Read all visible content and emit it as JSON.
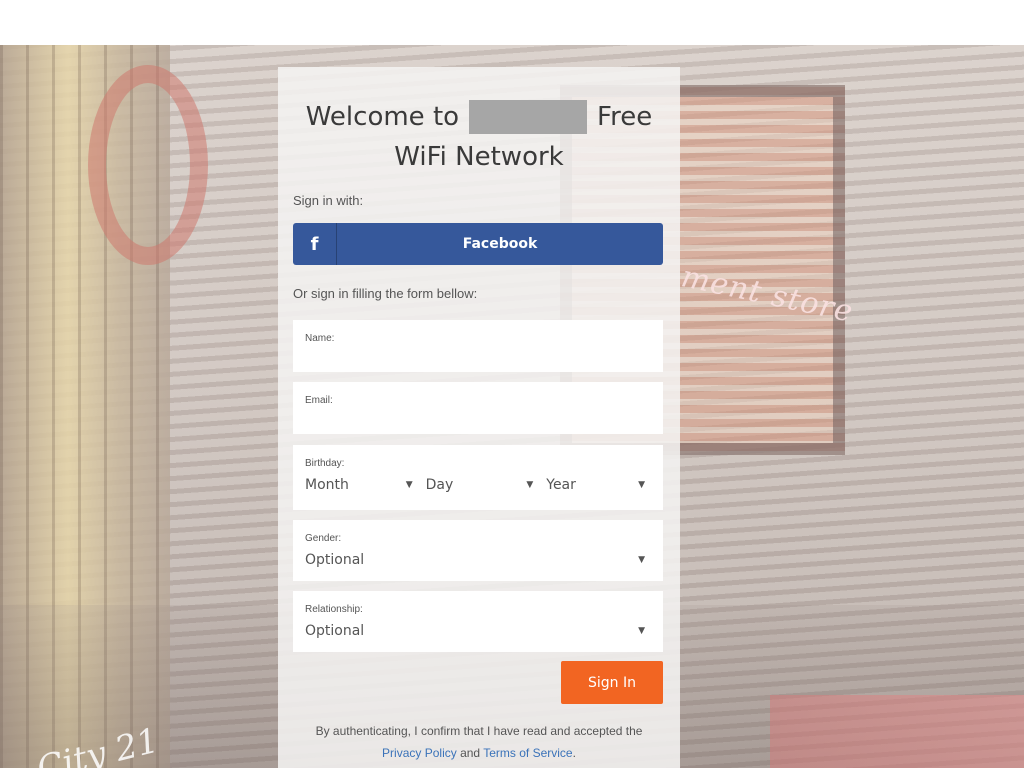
{
  "title": {
    "prefix": "Welcome to",
    "suffix": "Free",
    "line2": "WiFi Network"
  },
  "signin_with_label": "Sign in with:",
  "facebook": {
    "icon_glyph": "f",
    "label": "Facebook",
    "color": "#36589b"
  },
  "form_intro": "Or sign in filling the form bellow:",
  "fields": {
    "name": {
      "label": "Name:",
      "value": ""
    },
    "email": {
      "label": "Email:",
      "value": ""
    },
    "birthday": {
      "label": "Birthday:",
      "month": "Month",
      "day": "Day",
      "year": "Year"
    },
    "gender": {
      "label": "Gender:",
      "value": "Optional"
    },
    "relationship": {
      "label": "Relationship:",
      "value": "Optional"
    }
  },
  "signin_button": {
    "label": "Sign In",
    "color": "#f26522"
  },
  "disclaimer": {
    "text": "By authenticating, I confirm that I have read and accepted the",
    "privacy": "Privacy Policy",
    "and": "and",
    "terms": "Terms of Service",
    "period": "."
  },
  "background": {
    "neon_text": "ment store",
    "script_text": "City 21"
  }
}
